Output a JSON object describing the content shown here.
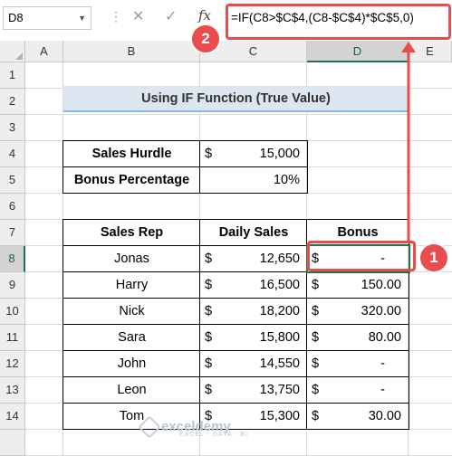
{
  "formula_bar": {
    "name_box": "D8",
    "cancel_icon": "✕",
    "enter_icon": "✓",
    "fx_label": "fx",
    "formula": "=IF(C8>$C$4,(C8-$C$4)*$C$5,0)"
  },
  "columns": [
    "A",
    "B",
    "C",
    "D",
    "E"
  ],
  "rows": [
    "1",
    "2",
    "3",
    "4",
    "5",
    "6",
    "7",
    "8",
    "9",
    "10",
    "11",
    "12",
    "13",
    "14"
  ],
  "title": "Using IF Function (True Value)",
  "params": {
    "hurdle_label": "Sales Hurdle",
    "hurdle_currency": "$",
    "hurdle_value": "15,000",
    "bonus_label": "Bonus Percentage",
    "bonus_value": "10%"
  },
  "table": {
    "headers": [
      "Sales Rep",
      "Daily Sales",
      "Bonus"
    ],
    "rows": [
      {
        "rep": "Jonas",
        "cur": "$",
        "sales": "12,650",
        "bcur": "$",
        "bonus": "-"
      },
      {
        "rep": "Harry",
        "cur": "$",
        "sales": "16,500",
        "bcur": "$",
        "bonus": "150.00"
      },
      {
        "rep": "Nick",
        "cur": "$",
        "sales": "18,200",
        "bcur": "$",
        "bonus": "320.00"
      },
      {
        "rep": "Sara",
        "cur": "$",
        "sales": "15,800",
        "bcur": "$",
        "bonus": "80.00"
      },
      {
        "rep": "John",
        "cur": "$",
        "sales": "14,550",
        "bcur": "$",
        "bonus": "-"
      },
      {
        "rep": "Leon",
        "cur": "$",
        "sales": "13,750",
        "bcur": "$",
        "bonus": "-"
      },
      {
        "rep": "Tom",
        "cur": "$",
        "sales": "15,300",
        "bcur": "$",
        "bonus": "30.00"
      }
    ]
  },
  "annotations": {
    "badge_1": "1",
    "badge_2": "2",
    "arrow_color": "#e84c4c"
  },
  "watermark": {
    "name": "exceldemy",
    "tagline": "EXCEL · DATA · BI"
  }
}
